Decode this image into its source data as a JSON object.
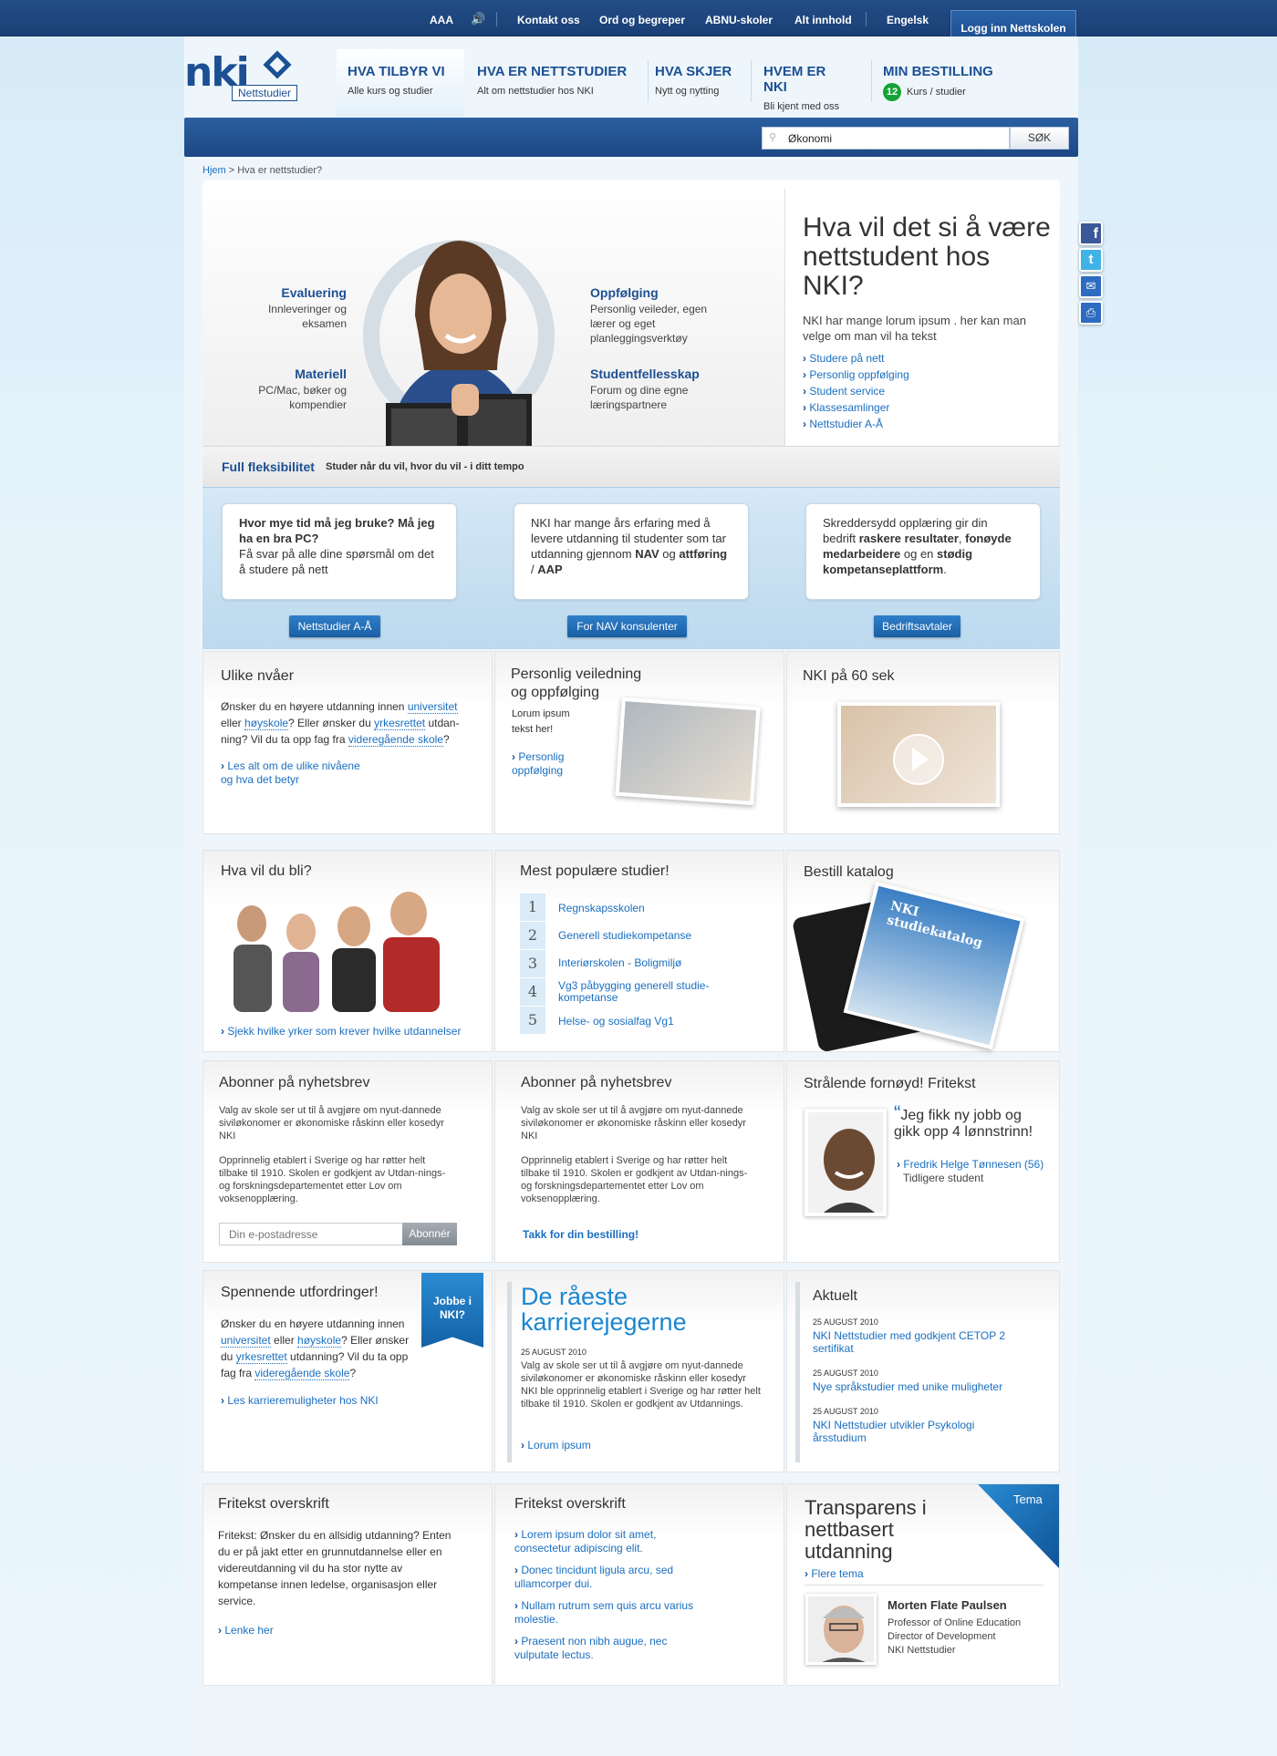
{
  "topnav": {
    "aaa": "AAA",
    "contact": "Kontakt oss",
    "glossary": "Ord og begreper",
    "abnu": "ABNU-skoler",
    "all": "Alt innhold",
    "english": "Engelsk",
    "login": "Logg inn Nettskolen"
  },
  "logo": {
    "main": "nki",
    "sub": "Nettstudier"
  },
  "mainnav": [
    {
      "title": "HVA TILBYR VI",
      "sub": "Alle kurs og studier"
    },
    {
      "title": "HVA ER NETTSTUDIER",
      "sub": "Alt om nettstudier hos NKI"
    },
    {
      "title": "HVA SKJER",
      "sub": "Nytt og nytting"
    },
    {
      "title": "HVEM ER NKI",
      "sub": "Bli kjent med oss"
    },
    {
      "title": "MIN BESTILLING",
      "sub": "Kurs / studier",
      "badge": "12"
    }
  ],
  "search": {
    "value": "Økonomi",
    "button": "SØK"
  },
  "breadcrumb": {
    "home": "Hjem",
    "current": "> Hva er nettstudier?"
  },
  "hero": {
    "title": "Hva vil det si å være nettstudent hos NKI?",
    "text": "NKI har mange lorum ipsum . her kan man velge om man vil ha tekst",
    "links": [
      "Studere på nett",
      "Personlig oppfølging",
      "Student service",
      "Klassesamlinger",
      "Nettstudier A-Å"
    ],
    "features": [
      {
        "title": "Evaluering",
        "sub": "Innleveringer og eksamen"
      },
      {
        "title": "Materiell",
        "sub": "PC/Mac, bøker og kompendier"
      },
      {
        "title": "Oppfølging",
        "sub": "Personlig veileder, egen lærer og eget planleggingsverktøy"
      },
      {
        "title": "Studentfellesskap",
        "sub": "Forum og dine egne læringspartnere"
      }
    ]
  },
  "flex": {
    "title": "Full fleksibilitet",
    "sub": "Studer når du vil, hvor du vil - i ditt tempo"
  },
  "bubbles": {
    "b1q": "Hvor mye tid må jeg bruke? Må jeg ha en bra PC?",
    "b1t": "Få svar på alle dine spørsmål om det å studere på nett",
    "b1btn": "Nettstudier A-Å",
    "b2a": "NKI har mange års erfaring med å levere utdanning til studenter som tar utdanning gjennom ",
    "b2b": "NAV",
    "b2c": " og ",
    "b2d": "attføring",
    "b2e": " / ",
    "b2f": "AAP",
    "b2btn": "For NAV konsulenter",
    "b3a": "Skreddersydd opplæring gir din bedrift ",
    "b3b": "raskere resultater",
    "b3c": ", ",
    "b3d": "fonøyde medarbeidere",
    "b3e": " og en ",
    "b3f": "stødig kompetanseplattform",
    "b3g": ".",
    "b3btn": "Bedriftsavtaler"
  },
  "row1": {
    "levels": {
      "title": "Ulike nvåer",
      "t1": "Ønsker du en høyere utdanning innen ",
      "l1": "universitet",
      "t2": " eller ",
      "l2": "høyskole",
      "t3": "? Eller ønsker du ",
      "l3": "yrkesrettet",
      "t4": " utdan-ning? Vil du ta opp fag fra ",
      "l4": "videregående skole",
      "t5": "?",
      "link": "Les alt om de ulike nivåene og hva det betyr"
    },
    "guidance": {
      "title": "Personlig veiledning og oppfølging",
      "text": "Lorum ipsum tekst her!",
      "link": "Personlig oppfølging"
    },
    "video": {
      "title": "NKI på 60 sek"
    }
  },
  "row2": {
    "become": {
      "title": "Hva vil du bli?",
      "link": "Sjekk hvilke yrker som krever hvilke utdannelser"
    },
    "popular": {
      "title": "Mest populære studier!",
      "items": [
        "Regnskapsskolen",
        "Generell studiekompetanse",
        "Interiørskolen - Boligmiljø",
        "Vg3 påbygging generell studie-kompetanse",
        "Helse- og sosialfag Vg1"
      ],
      "nums": [
        "1",
        "2",
        "3",
        "4",
        "5"
      ]
    },
    "catalog": {
      "title": "Bestill katalog",
      "cover": "NKI studiekatalog"
    }
  },
  "row3": {
    "news1": {
      "title": "Abonner på nyhetsbrev",
      "p1": "Valg av skole ser ut til å avgjøre om nyut-dannede siviløkonomer er økonomiske råskinn eller kosedyr NKI",
      "p2": "Opprinnelig etablert i Sverige og har røtter helt tilbake til 1910. Skolen er godkjent av Utdan-nings- og forskningsdepartementet etter Lov om voksenopplæring.",
      "placeholder": "Din e-postadresse",
      "button": "Abonnér"
    },
    "news2": {
      "title": "Abonner på nyhetsbrev",
      "p1": "Valg av skole ser ut til å avgjøre om nyut-dannede siviløkonomer er økonomiske råskinn eller kosedyr NKI",
      "p2": "Opprinnelig etablert i Sverige og har røtter helt tilbake til 1910. Skolen er godkjent av Utdan-nings- og forskningsdepartementet etter Lov om voksenopplæring.",
      "thanks": "Takk for din bestilling!"
    },
    "testimonial": {
      "title": "Strålende fornøyd! Fritekst",
      "quote": "Jeg fikk ny jobb og gikk opp 4 lønnstrinn!",
      "name": "Fredrik Helge Tønnesen (56)",
      "role": "Tidligere student"
    }
  },
  "row4": {
    "challenges": {
      "title": "Spennende utfordringer!",
      "t1": "Ønsker du en høyere utdanning innen ",
      "l1": "universitet",
      "t2": " eller ",
      "l2": "høyskole",
      "t3": "? Eller ønsker du ",
      "l3": "yrkesrettet",
      "t4": " utdanning? Vil du ta opp fag fra ",
      "l4": "videregående skole",
      "t5": "?",
      "link": "Les karrieremuligheter hos NKI",
      "ribbon": "Jobbe i NKI?"
    },
    "hunters": {
      "title": "De råeste karrierejegerne",
      "date": "25 AUGUST 2010",
      "text": "Valg av skole ser ut til å avgjøre om nyut-dannede siviløkonomer er økonomiske råskinn eller kosedyr NKI ble opprinnelig etablert i Sverige og har røtter helt tilbake til 1910. Skolen er godkjent av Utdannings.",
      "link": "Lorum ipsum"
    },
    "news": {
      "title": "Aktuelt",
      "items": [
        {
          "date": "25 AUGUST 2010",
          "text": "NKI Nettstudier med godkjent CETOP 2 sertifikat"
        },
        {
          "date": "25 AUGUST 2010",
          "text": "Nye språkstudier med unike muligheter"
        },
        {
          "date": "25 AUGUST 2010",
          "text": "NKI Nettstudier utvikler Psykologi årsstudium"
        }
      ]
    }
  },
  "row5": {
    "free1": {
      "title": "Fritekst overskrift",
      "text": "Fritekst: Ønsker du en allsidig utdanning? Enten du er på jakt etter en grunnutdannelse eller en videreutdanning vil du ha stor nytte av kompetanse innen ledelse, organisasjon eller service.",
      "link": "Lenke her"
    },
    "free2": {
      "title": "Fritekst overskrift",
      "links": [
        "Lorem ipsum dolor sit amet, consectetur adipiscing elit.",
        "Donec tincidunt ligula arcu, sed ullamcorper dui.",
        "Nullam rutrum sem quis arcu varius molestie.",
        "Praesent non nibh augue, nec vulputate lectus."
      ]
    },
    "theme": {
      "tag": "Tema",
      "title": "Transparens i nettbasert utdanning",
      "link": "Flere tema",
      "name": "Morten Flate Paulsen",
      "role1": "Professor of Online Education",
      "role2": "Director of Development",
      "role3": "NKI Nettstudier"
    }
  },
  "colors": {
    "brand": "#1c4f93",
    "link": "#1a6fc0",
    "green": "#16a336"
  }
}
